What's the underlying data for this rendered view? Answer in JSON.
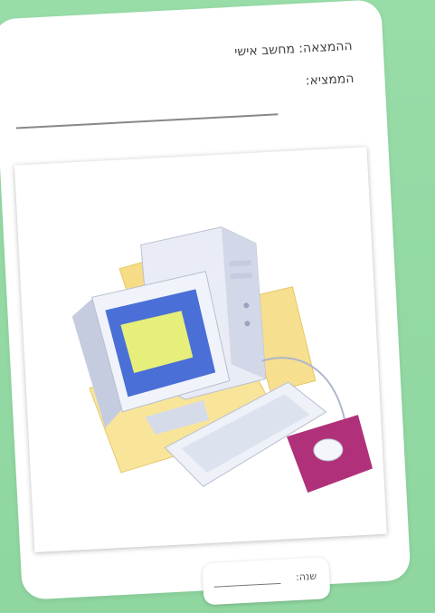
{
  "card": {
    "invention_line": "ההמצאה: מחשב אישי",
    "inventor_label": "הממציא:"
  },
  "picture": {
    "subject": "computer-illustration"
  },
  "year_box": {
    "label": "שנה:"
  },
  "colors": {
    "background": "#93d9a4",
    "card": "#ffffff",
    "screen": "#4a6fd6",
    "screen_window": "#e6ef7a",
    "mouse_pad": "#b0307a",
    "paper": "#f8e08c"
  }
}
